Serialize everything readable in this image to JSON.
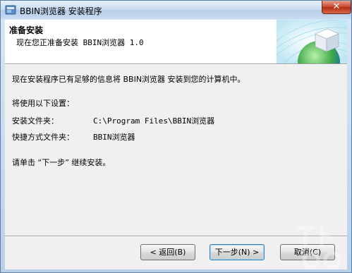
{
  "window": {
    "title": "BBIN浏览器 安装程序",
    "close_label": "✕"
  },
  "header": {
    "title": "准备安装",
    "subtitle": "现在您正准备安装 BBIN浏览器 1.0"
  },
  "body": {
    "intro": "现在安装程序已有足够的信息将 BBIN浏览器 安装到您的计算机中。",
    "settings_heading": "将使用以下设置：",
    "install_folder_label": "安装文件夹：",
    "install_folder_value": "C:\\Program Files\\BBIN浏览器",
    "shortcut_folder_label": "快捷方式文件夹：",
    "shortcut_folder_value": "BBIN浏览器",
    "instruction": "请单击 “下一步” 继续安装。"
  },
  "buttons": {
    "back": "< 返回(B)",
    "next": "下一步(N) >",
    "cancel": "取消(C)"
  },
  "colors": {
    "accent": "#3c7fb1",
    "client_bg": "#f0f0f0"
  }
}
